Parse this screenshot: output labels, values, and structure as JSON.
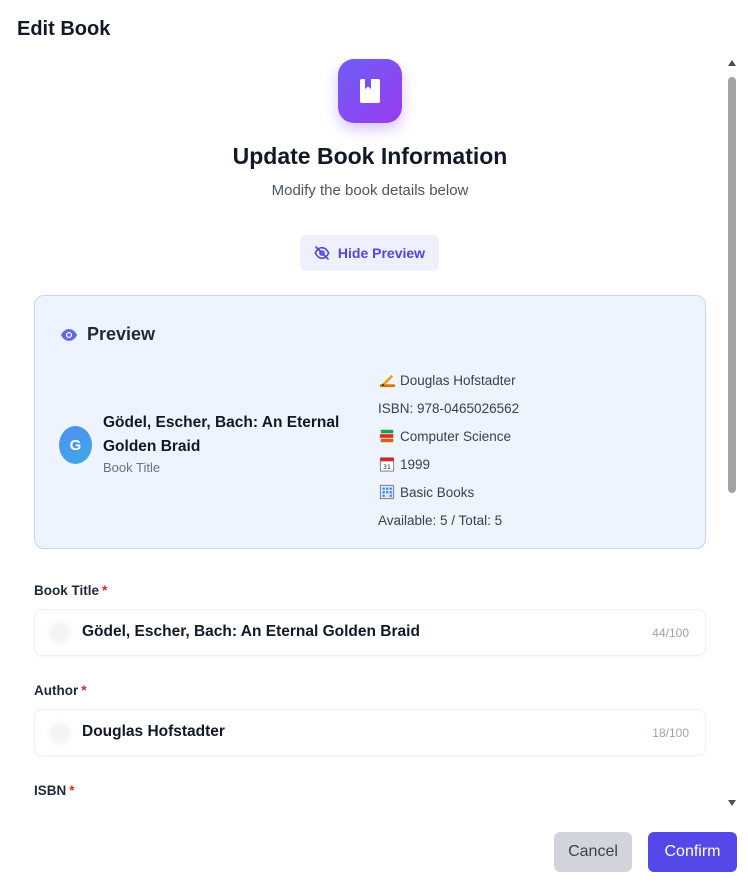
{
  "dialog": {
    "title": "Edit Book",
    "heading": "Update Book Information",
    "subheading": "Modify the book details below",
    "toggle_preview_label": "Hide Preview"
  },
  "preview": {
    "header": "Preview",
    "avatar_letter": "G",
    "title": "Gödel, Escher, Bach: An Eternal Golden Braid",
    "title_caption": "Book Title",
    "author": "Douglas Hofstadter",
    "isbn": "ISBN: 978-0465026562",
    "category": "Computer Science",
    "year": "1999",
    "publisher": "Basic Books",
    "availability": "Available: 5 / Total: 5"
  },
  "form": {
    "title": {
      "label": "Book Title",
      "required_mark": "*",
      "value": "Gödel, Escher, Bach: An Eternal Golden Braid",
      "counter": "44/100"
    },
    "author": {
      "label": "Author",
      "required_mark": "*",
      "value": "Douglas Hofstadter",
      "counter": "18/100"
    },
    "isbn": {
      "label": "ISBN",
      "required_mark": "*"
    }
  },
  "actions": {
    "cancel": "Cancel",
    "confirm": "Confirm"
  },
  "icons": {
    "hero": "book-icon",
    "toggle": "eye-off-icon",
    "preview": "eye-icon",
    "author": "pen-icon",
    "category": "books-icon",
    "year": "calendar-icon",
    "publisher": "building-icon"
  },
  "colors": {
    "accent": "#5548e8",
    "preview_bg": "#eef4fd",
    "required": "#dc2626"
  }
}
